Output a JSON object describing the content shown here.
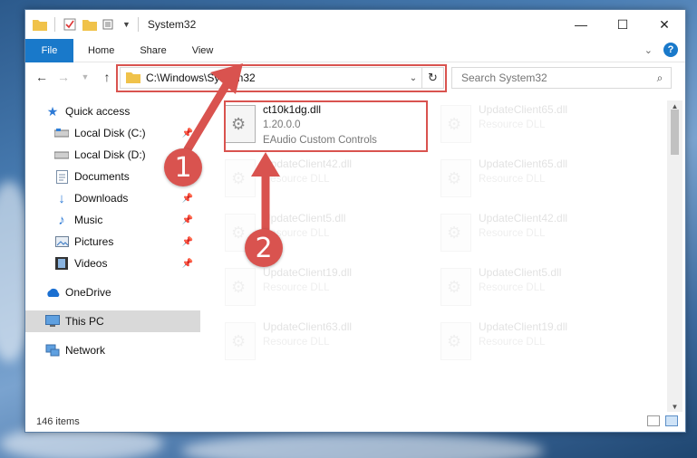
{
  "window": {
    "title": "System32"
  },
  "ribbon": {
    "tabs": [
      "File",
      "Home",
      "Share",
      "View"
    ],
    "help": "?"
  },
  "address": {
    "path": "C:\\Windows\\System32"
  },
  "search": {
    "placeholder": "Search System32"
  },
  "sidebar": {
    "items": [
      {
        "label": "Quick access",
        "icon": "star-icon",
        "pinned": false
      },
      {
        "label": "Local Disk (C:)",
        "icon": "drive-icon",
        "pinned": true
      },
      {
        "label": "Local Disk (D:)",
        "icon": "drive-icon",
        "pinned": false
      },
      {
        "label": "Documents",
        "icon": "documents-icon",
        "pinned": false
      },
      {
        "label": "Downloads",
        "icon": "download-icon",
        "pinned": true
      },
      {
        "label": "Music",
        "icon": "music-icon",
        "pinned": true
      },
      {
        "label": "Pictures",
        "icon": "pictures-icon",
        "pinned": true
      },
      {
        "label": "Videos",
        "icon": "videos-icon",
        "pinned": true
      },
      {
        "label": "OneDrive",
        "icon": "cloud-icon",
        "pinned": false
      },
      {
        "label": "This PC",
        "icon": "computer-icon",
        "pinned": false,
        "selected": true
      },
      {
        "label": "Network",
        "icon": "network-icon",
        "pinned": false
      }
    ]
  },
  "files": {
    "highlighted": {
      "name": "ct10k1dg.dll",
      "version": "1.20.0.0",
      "description": "EAudio Custom Controls"
    },
    "left": [
      {
        "name": "UpdateClient42.dll",
        "type": "Resource DLL"
      },
      {
        "name": "UpdateClient5.dll",
        "type": "Resource DLL"
      },
      {
        "name": "UpdateClient19.dll",
        "type": "Resource DLL"
      },
      {
        "name": "UpdateClient63.dll",
        "type": "Resource DLL"
      }
    ],
    "right": [
      {
        "name": "UpdateClient65.dll",
        "type": "Resource DLL"
      },
      {
        "name": "UpdateClient65.dll",
        "type": "Resource DLL"
      },
      {
        "name": "UpdateClient42.dll",
        "type": "Resource DLL"
      },
      {
        "name": "UpdateClient5.dll",
        "type": "Resource DLL"
      },
      {
        "name": "UpdateClient19.dll",
        "type": "Resource DLL"
      }
    ]
  },
  "status": {
    "items": "146 items"
  },
  "annotations": {
    "badge1": "1",
    "badge2": "2",
    "color": "#d9534f"
  }
}
